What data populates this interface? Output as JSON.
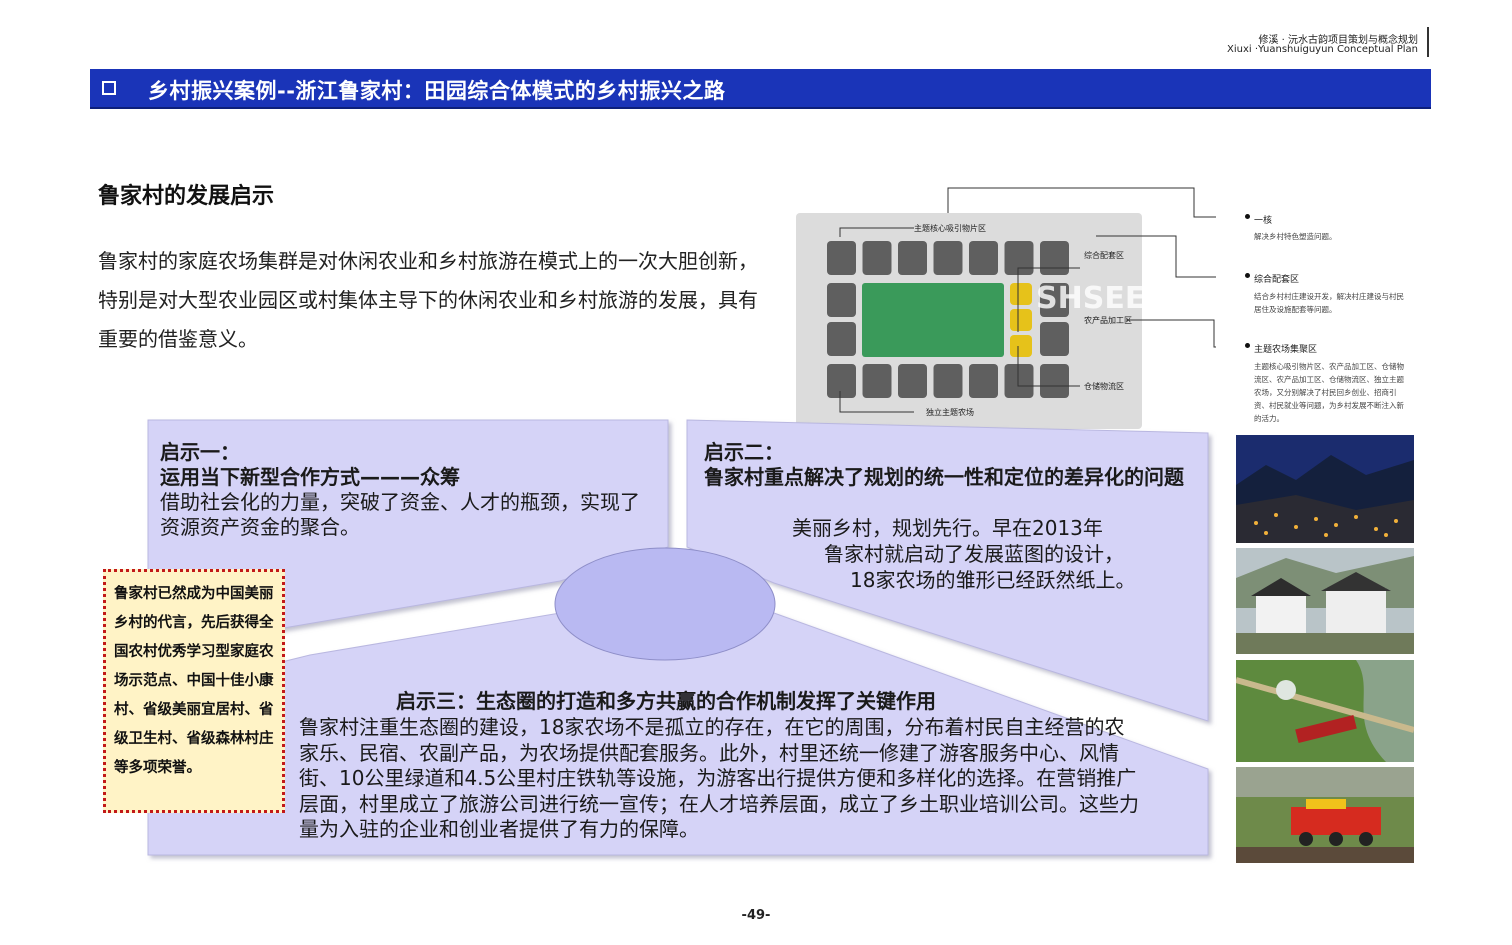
{
  "header": {
    "project_cn": "修溪 · 沅水古韵项目策划与概念规划",
    "project_en": "Xiuxi ·Yuanshuiguyun Conceptual Plan"
  },
  "title": "乡村振兴案例--浙江鲁家村：田园综合体模式的乡村振兴之路",
  "subheading": "鲁家村的发展启示",
  "intro": "鲁家村的家庭农场集群是对休闲农业和乡村旅游在模式上的一次大胆创新，特别是对大型农业园区或村集体主导下的休闲农业和乡村旅游的发展，具有重要的借鉴意义。",
  "diagram": {
    "labels": {
      "core_zone": "主题核心吸引物片区",
      "service_zone": "综合配套区",
      "processing_zone": "农产品加工区",
      "storage_zone": "仓储物流区",
      "independent_farm": "独立主题农场"
    },
    "watermark": "SHSEE",
    "side": [
      {
        "title": "一核",
        "desc": "解决乡村特色塑造问题。"
      },
      {
        "title": "综合配套区",
        "desc": "结合乡村村庄建设开发，解决村庄建设与村民居住及设施配套等问题。"
      },
      {
        "title": "主题农场集聚区",
        "desc": "主题核心吸引物片区、农产品加工区、仓储物流区、农产品加工区、仓储物流区、独立主题农场，又分别解决了村民回乡创业、招商引资、村民就业等问题，为乡村发展不断注入新的活力。"
      }
    ]
  },
  "panels": {
    "p1": {
      "label": "启示一：",
      "title": "运用当下新型合作方式———众筹",
      "body": "借助社会化的力量，突破了资金、人才的瓶颈，实现了资源资产资金的聚合。"
    },
    "p2": {
      "label": "启示二：",
      "title": "鲁家村重点解决了规划的统一性和定位的差异化的问题",
      "body_line1": "美丽乡村，规划先行。早在2013年",
      "body_line2": "鲁家村就启动了发展蓝图的设计，",
      "body_line3": "18家农场的雏形已经跃然纸上。"
    },
    "p3": {
      "title": "启示三：生态圈的打造和多方共赢的合作机制发挥了关键作用",
      "body": "鲁家村注重生态圈的建设，18家农场不是孤立的存在，在它的周围，分布着村民自主经营的农家乐、民宿、农副产品，为农场提供配套服务。此外，村里还统一修建了游客服务中心、风情街、10公里绿道和4.5公里村庄铁轨等设施，为游客出行提供方便和多样化的选择。在营销推广层面，村里成立了旅游公司进行统一宣传；在人才培养层面，成立了乡土职业培训公司。这些力量为入驻的企业和创业者提供了有力的保障。"
    }
  },
  "honor": "鲁家村已然成为中国美丽乡村的代言，先后获得全国农村优秀学习型家庭农场示范点、中国十佳小康村、省级美丽宜居村、省级卫生村、省级森林村庄等多项荣誉。",
  "page_number": "-49-",
  "colors": {
    "title_bar": "#1a34b8",
    "panel_fill": "#d5d3f7",
    "ellipse_fill": "#b9b9f2",
    "honor_fill": "#fff3c6",
    "honor_border": "#c21818",
    "green_core": "#3a9a5a",
    "yellow_cells": "#e6c21a",
    "gray_cells": "#5f5f5f"
  }
}
